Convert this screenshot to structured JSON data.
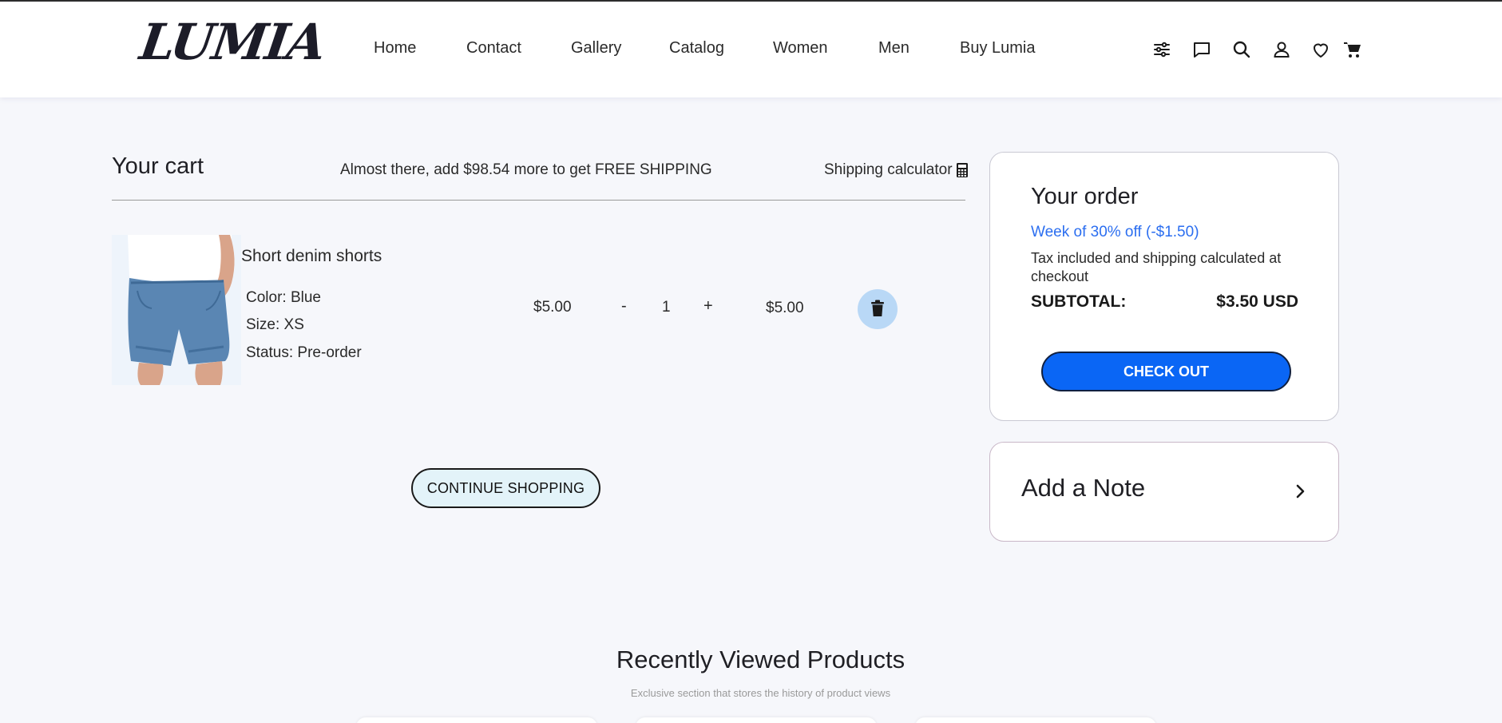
{
  "header": {
    "logo": "LUMIA",
    "nav": [
      "Home",
      "Contact",
      "Gallery",
      "Catalog",
      "Women",
      "Men",
      "Buy Lumia"
    ],
    "icons": [
      "filter-icon",
      "chat-icon",
      "search-icon",
      "user-icon",
      "heart-icon",
      "cart-icon"
    ]
  },
  "cart": {
    "title": "Your cart",
    "free_shipping_message": "Almost there, add $98.54 more to get FREE SHIPPING",
    "shipping_calculator": "Shipping calculator",
    "items": [
      {
        "name": "Short denim shorts",
        "color": "Color: Blue",
        "size": "Size: XS",
        "status": "Status: Pre-order",
        "unit_price": "$5.00",
        "quantity": "1",
        "line_total": "$5.00",
        "qty_minus": "-",
        "qty_plus": "+"
      }
    ],
    "continue_shopping": "CONTINUE SHOPPING"
  },
  "order": {
    "title": "Your order",
    "promo": "Week of 30% off (-$1.50)",
    "tax_note": "Tax included and shipping calculated at checkout",
    "subtotal_label": "SUBTOTAL:",
    "subtotal_value": "$3.50 USD",
    "checkout": "CHECK OUT"
  },
  "note": {
    "title": "Add a Note"
  },
  "recent": {
    "title": "Recently Viewed Products",
    "subtitle": "Exclusive section that stores the history of product views"
  },
  "colors": {
    "accent_blue": "#0a66f5",
    "promo_blue": "#2b6ef0",
    "page_bg": "#f6f7fb",
    "delete_bg": "#b9d8f6",
    "continue_bg": "#e3f3f9"
  }
}
